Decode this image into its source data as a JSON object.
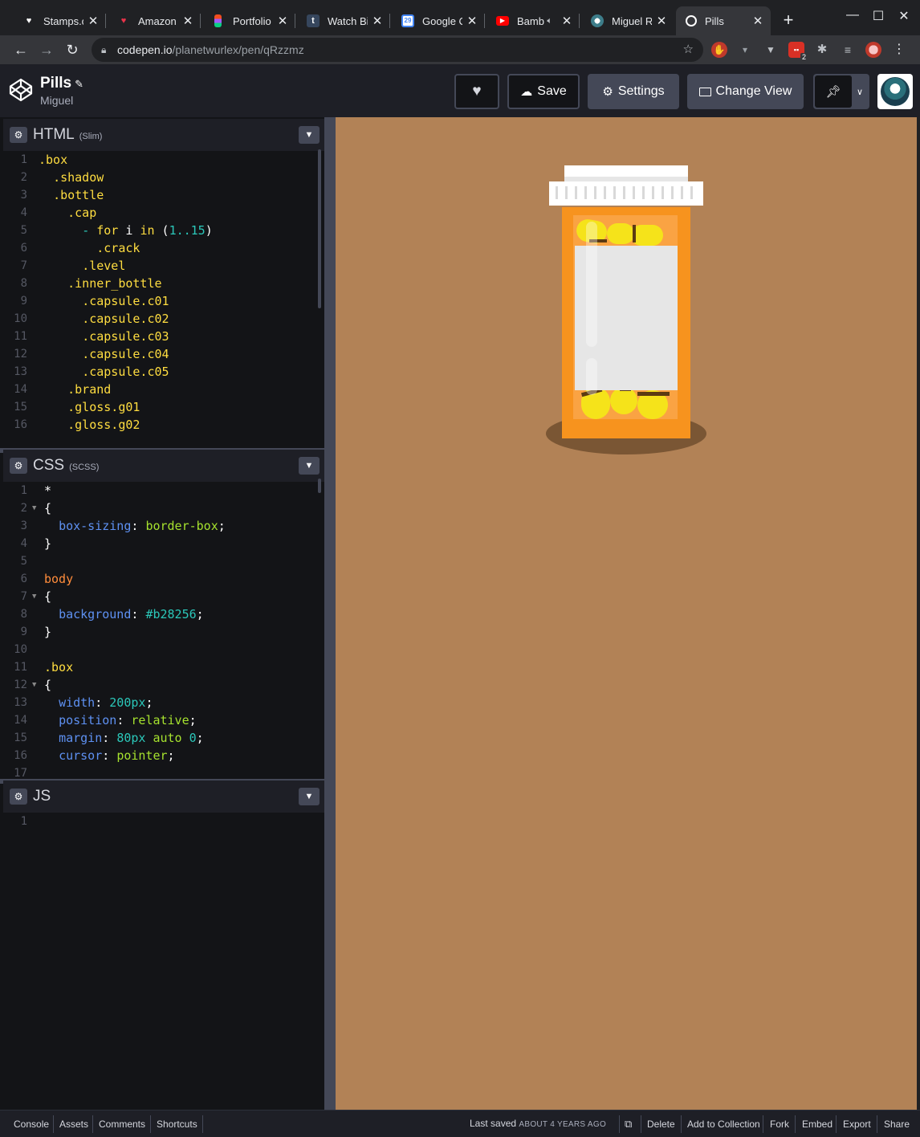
{
  "browser": {
    "tabs": [
      {
        "title": "Stamps.c",
        "icon": "stamps-icon"
      },
      {
        "title": "Amazon",
        "icon": "amazon-icon"
      },
      {
        "title": "Portfolio",
        "icon": "figma-icon"
      },
      {
        "title": "Watch Bi",
        "icon": "tumblr-icon"
      },
      {
        "title": "Google C",
        "icon": "google-calendar-icon"
      },
      {
        "title": "Bamb",
        "icon": "youtube-icon"
      },
      {
        "title": "Miguel R",
        "icon": "globe-icon"
      },
      {
        "title": "Pills",
        "icon": "codepen-icon"
      }
    ],
    "url_host": "codepen.io",
    "url_path": "/planetwurlex/pen/qRzzmz",
    "extension_badge": "2"
  },
  "header": {
    "title": "Pills",
    "author": "Miguel",
    "buttons": {
      "save": "Save",
      "settings": "Settings",
      "change_view": "Change View"
    }
  },
  "panels": {
    "html": {
      "name": "HTML",
      "sub": "(Slim)"
    },
    "css": {
      "name": "CSS",
      "sub": "(SCSS)"
    },
    "js": {
      "name": "JS",
      "sub": ""
    }
  },
  "html_code": [
    ".box",
    "  .shadow",
    "  .bottle",
    "    .cap",
    "      - for i in (1..15)",
    "        .crack",
    "      .level",
    "    .inner_bottle",
    "      .capsule.c01",
    "      .capsule.c02",
    "      .capsule.c03",
    "      .capsule.c04",
    "      .capsule.c05",
    "    .brand",
    "    .gloss.g01",
    "    .gloss.g02"
  ],
  "css_code": [
    "*",
    "{",
    "  box-sizing: border-box;",
    "}",
    "",
    "body",
    "{",
    "  background: #b28256;",
    "}",
    "",
    ".box",
    "{",
    "  width: 200px;",
    "  position: relative;",
    "  margin: 80px auto 0;",
    "  cursor: pointer;",
    ""
  ],
  "js_code": [
    ""
  ],
  "colors": {
    "preview_bg": "#b28256",
    "bottle": "#f7931e",
    "cap": "#ffffff",
    "label": "#e6e6e6",
    "capsule": "#f5e31a"
  },
  "footer": {
    "left": [
      "Console",
      "Assets",
      "Comments",
      "Shortcuts"
    ],
    "saved_prefix": "Last saved",
    "saved_when": "ABOUT 4 YEARS AGO",
    "right": [
      "Delete",
      "Add to Collection",
      "Fork",
      "Embed",
      "Export",
      "Share"
    ]
  }
}
